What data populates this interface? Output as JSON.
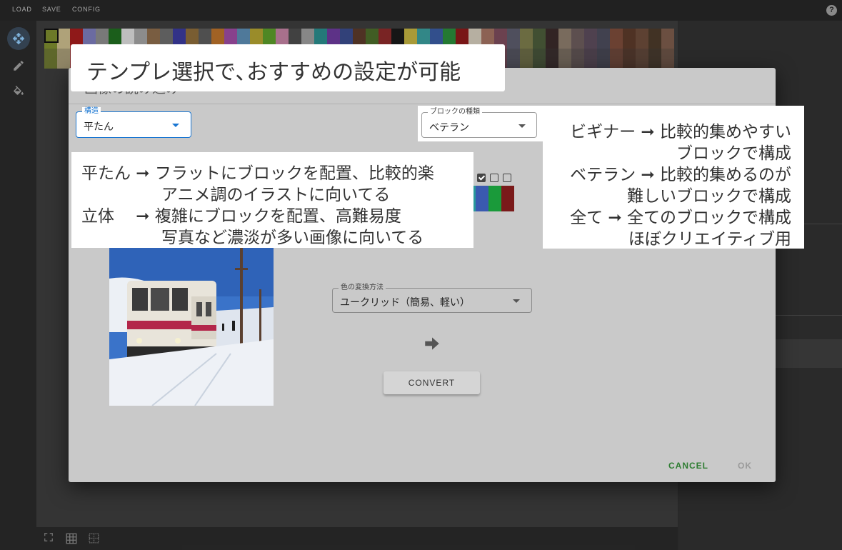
{
  "menu": {
    "load": "LOAD",
    "save": "SAVE",
    "config": "CONFIG"
  },
  "tools": {
    "move": "move-icon",
    "pencil": "pencil-icon",
    "fill": "paint-bucket-icon"
  },
  "bottom_tools": {
    "fullscreen": "fullscreen-icon",
    "grid": "grid-icon",
    "grid_dashed": "dashed-grid-icon"
  },
  "dialog": {
    "title": "画像の読み込み",
    "structure": {
      "label": "構造",
      "value": "平たん"
    },
    "block_type": {
      "label": "ブロックの種類",
      "value": "ベテラン"
    },
    "color_method": {
      "label": "色の変換方法",
      "value": "ユークリッド（簡易、軽い）"
    },
    "convert_label": "CONVERT",
    "cancel_label": "CANCEL",
    "ok_label": "OK"
  },
  "annotations": {
    "top": "テンプレ選択で､おすすめの設定が可能",
    "structure_lines": [
      "平たん ➞ フラットにブロックを配置、比較的楽",
      "アニメ調のイラストに向いてる",
      "立体　 ➞ 複雑にブロックを配置、高難易度",
      "写真など濃淡が多い画像に向いてる"
    ],
    "block_lines": [
      "ビギナー ➞ 比較的集めやすい",
      "ブロックで構成",
      "ベテラン ➞ 比較的集めるのが",
      "難しいブロックで構成",
      "全て ➞ 全てのブロックで構成",
      "ほぼクリエイティブ用"
    ]
  },
  "colors": {
    "accent": "#1976d2",
    "cancel": "#2e7d32",
    "ok_disabled": "#9a9a9a",
    "palette_selected": "#7c8a2e"
  }
}
